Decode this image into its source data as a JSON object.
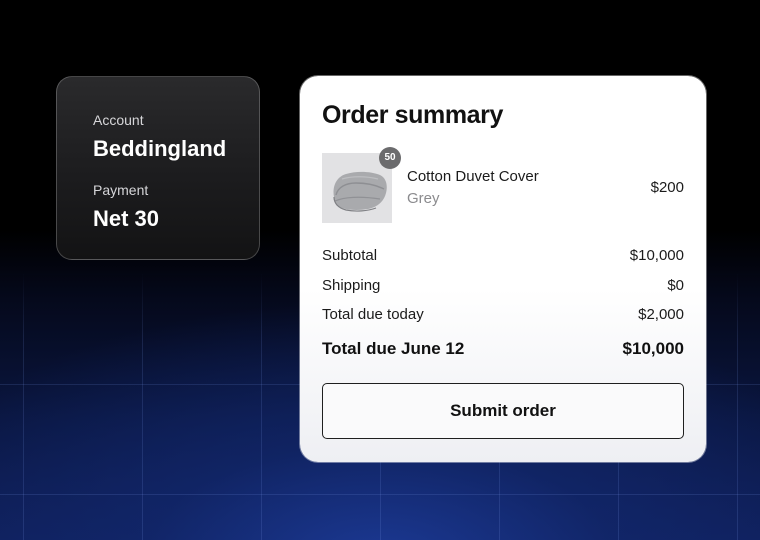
{
  "account": {
    "account_label": "Account",
    "account_value": "Beddingland",
    "payment_label": "Payment",
    "payment_value": "Net 30"
  },
  "order": {
    "title": "Order summary",
    "product": {
      "name": "Cotton Duvet Cover",
      "variant": "Grey",
      "price": "$200",
      "quantity": "50",
      "image_icon": "duvet-product-image"
    },
    "rows": [
      {
        "label": "Subtotal",
        "value": "$10,000"
      },
      {
        "label": "Shipping",
        "value": "$0"
      },
      {
        "label": "Total due today",
        "value": "$2,000"
      }
    ],
    "total": {
      "label": "Total due June 12",
      "value": "$10,000"
    },
    "submit_label": "Submit order"
  },
  "colors": {
    "background_top": "#000000",
    "background_bottom": "#0f1f5a",
    "account_card": "#1c1c1e",
    "badge": "#6b6b6d",
    "variant_text": "#8b8b8e"
  }
}
